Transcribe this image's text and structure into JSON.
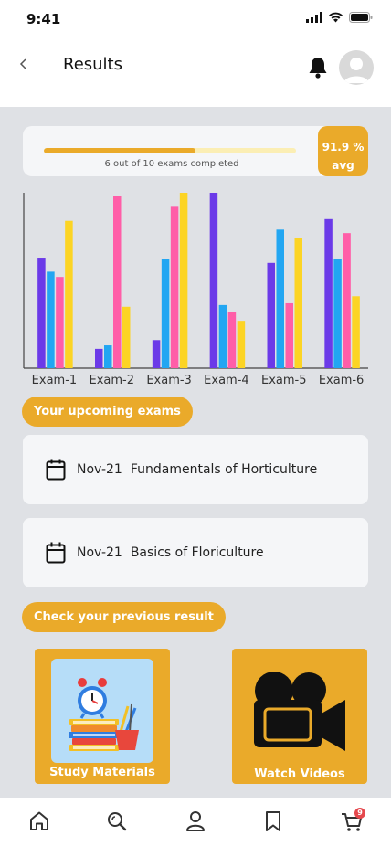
{
  "status_bar": {
    "time": "9:41"
  },
  "header": {
    "title": "Results"
  },
  "progress": {
    "completed": 6,
    "total": 10,
    "fraction": 0.6,
    "text": "6 out of 10 exams completed",
    "avg_value": "91.9 %",
    "avg_label": "avg"
  },
  "chart_data": {
    "type": "bar",
    "categories": [
      "Exam-1",
      "Exam-2",
      "Exam-3",
      "Exam-4",
      "Exam-5",
      "Exam-6"
    ],
    "ylim": [
      0,
      100
    ],
    "series": [
      {
        "color": "#6b3ae8",
        "values": [
          63,
          11,
          16,
          100,
          60,
          85
        ]
      },
      {
        "color": "#22a6f2",
        "values": [
          55,
          13,
          62,
          36,
          79,
          62
        ]
      },
      {
        "color": "#ff5ea8",
        "values": [
          52,
          98,
          92,
          32,
          37,
          77
        ]
      },
      {
        "color": "#fcd424",
        "values": [
          84,
          35,
          100,
          27,
          74,
          41
        ]
      }
    ]
  },
  "upcoming": {
    "label": "Your upcoming exams",
    "exams": [
      {
        "date": "Nov-21",
        "name": "Fundamentals of Horticulture"
      },
      {
        "date": "Nov-21",
        "name": "Basics of Floriculture"
      }
    ]
  },
  "previous": {
    "label": "Check your previous result"
  },
  "tiles": {
    "study": "Study Materials",
    "videos": "Watch Videos"
  },
  "nav": {
    "items": [
      "home-icon",
      "search-icon",
      "profile-icon",
      "bookmark-icon",
      "cart-icon"
    ],
    "cart_count": "9"
  },
  "colors": {
    "accent": "#eaaa2a",
    "background": "#dfe1e5"
  }
}
